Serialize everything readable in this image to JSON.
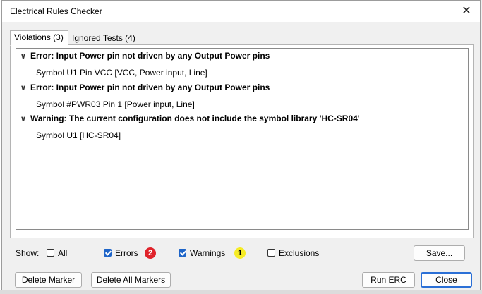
{
  "window": {
    "title": "Electrical Rules Checker"
  },
  "tabs": [
    {
      "label": "Violations (3)"
    },
    {
      "label": "Ignored Tests (4)"
    }
  ],
  "violations": [
    {
      "heading": "Error: Input Power pin not driven by any Output Power pins",
      "detail": "Symbol U1 Pin VCC [VCC, Power input, Line]"
    },
    {
      "heading": "Error: Input Power pin not driven by any Output Power pins",
      "detail": "Symbol #PWR03 Pin 1 [Power input, Line]"
    },
    {
      "heading": "Warning: The current configuration does not include the symbol library 'HC-SR04'",
      "detail": "Symbol U1 [HC-SR04]"
    }
  ],
  "filters": {
    "show_label": "Show:",
    "all": {
      "label": "All",
      "checked": false
    },
    "errors": {
      "label": "Errors",
      "checked": true,
      "count": "2"
    },
    "warnings": {
      "label": "Warnings",
      "checked": true,
      "count": "1"
    },
    "exclusions": {
      "label": "Exclusions",
      "checked": false
    }
  },
  "buttons": {
    "save": "Save...",
    "delete_marker": "Delete Marker",
    "delete_all_markers": "Delete All Markers",
    "run_erc": "Run ERC",
    "close": "Close"
  },
  "colors": {
    "error_badge": "#e0232b",
    "warning_badge": "#f6ec26",
    "checkbox_checked": "#1d64c8",
    "default_button_border": "#2a6fd6"
  }
}
